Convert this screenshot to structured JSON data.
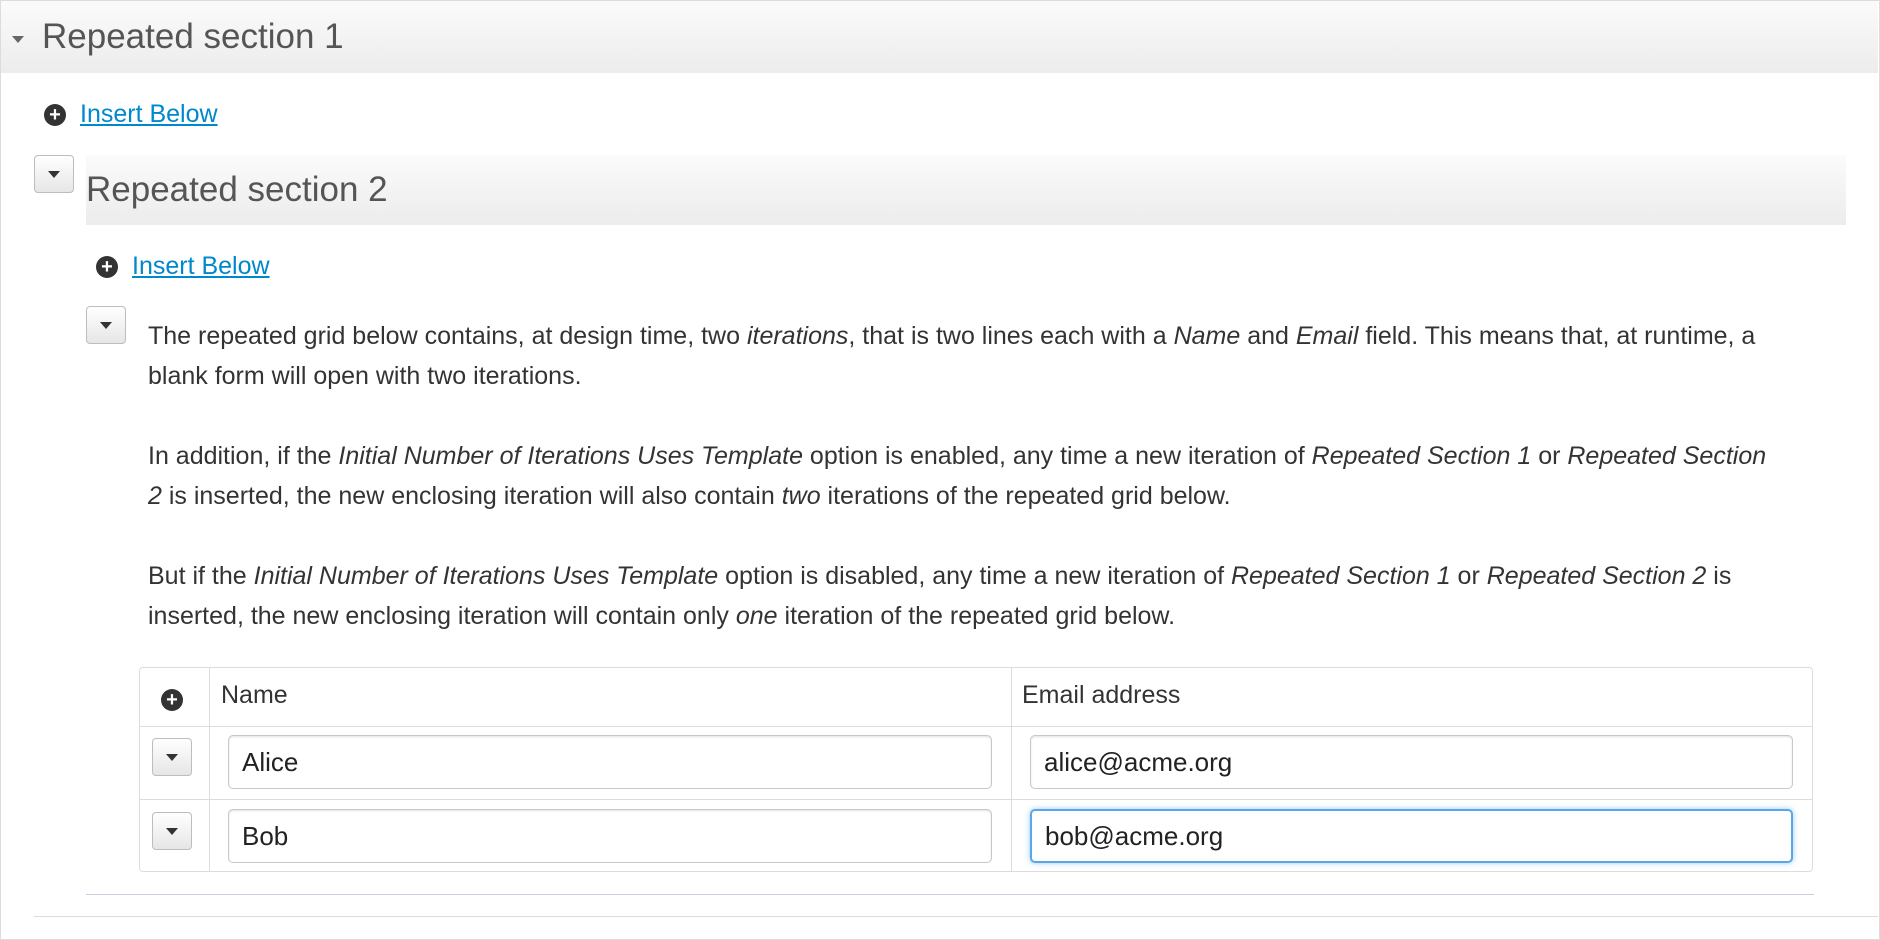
{
  "section1": {
    "title": "Repeated section 1",
    "insert_label": "Insert Below"
  },
  "section2": {
    "title": "Repeated section 2",
    "insert_label": "Insert Below"
  },
  "explanation": {
    "p1": [
      "The repeated grid below contains, at design time, two ",
      "iterations",
      ", that is two lines each with a ",
      "Name",
      " and ",
      "Email",
      " field. This means that, at runtime, a blank form will open with two iterations."
    ],
    "p2": [
      "In addition, if the ",
      "Initial Number of Iterations Uses Template",
      " option is enabled, any time a new iteration of ",
      "Repeated Section 1",
      " or ",
      "Repeated Section 2",
      " is inserted, the new enclosing iteration will also contain ",
      "two",
      " iterations of the repeated grid below."
    ],
    "p3": [
      "But if the ",
      "Initial Number of Iterations Uses Template",
      " option is disabled, any time a new iteration of ",
      "Repeated Section 1",
      " or ",
      "Repeated Section 2",
      " is inserted, the new enclosing iteration will contain only ",
      "one",
      " iteration of the repeated grid below."
    ]
  },
  "grid": {
    "headers": {
      "name": "Name",
      "email": "Email address"
    },
    "rows": [
      {
        "name": "Alice",
        "email": "alice@acme.org"
      },
      {
        "name": "Bob",
        "email": "bob@acme.org"
      }
    ]
  },
  "icons": {
    "caret": "caret-down-icon",
    "plus": "plus-circle-icon",
    "plus_glyph": "+"
  },
  "colors": {
    "link": "#0088cc",
    "focus": "#5aa7e8"
  }
}
